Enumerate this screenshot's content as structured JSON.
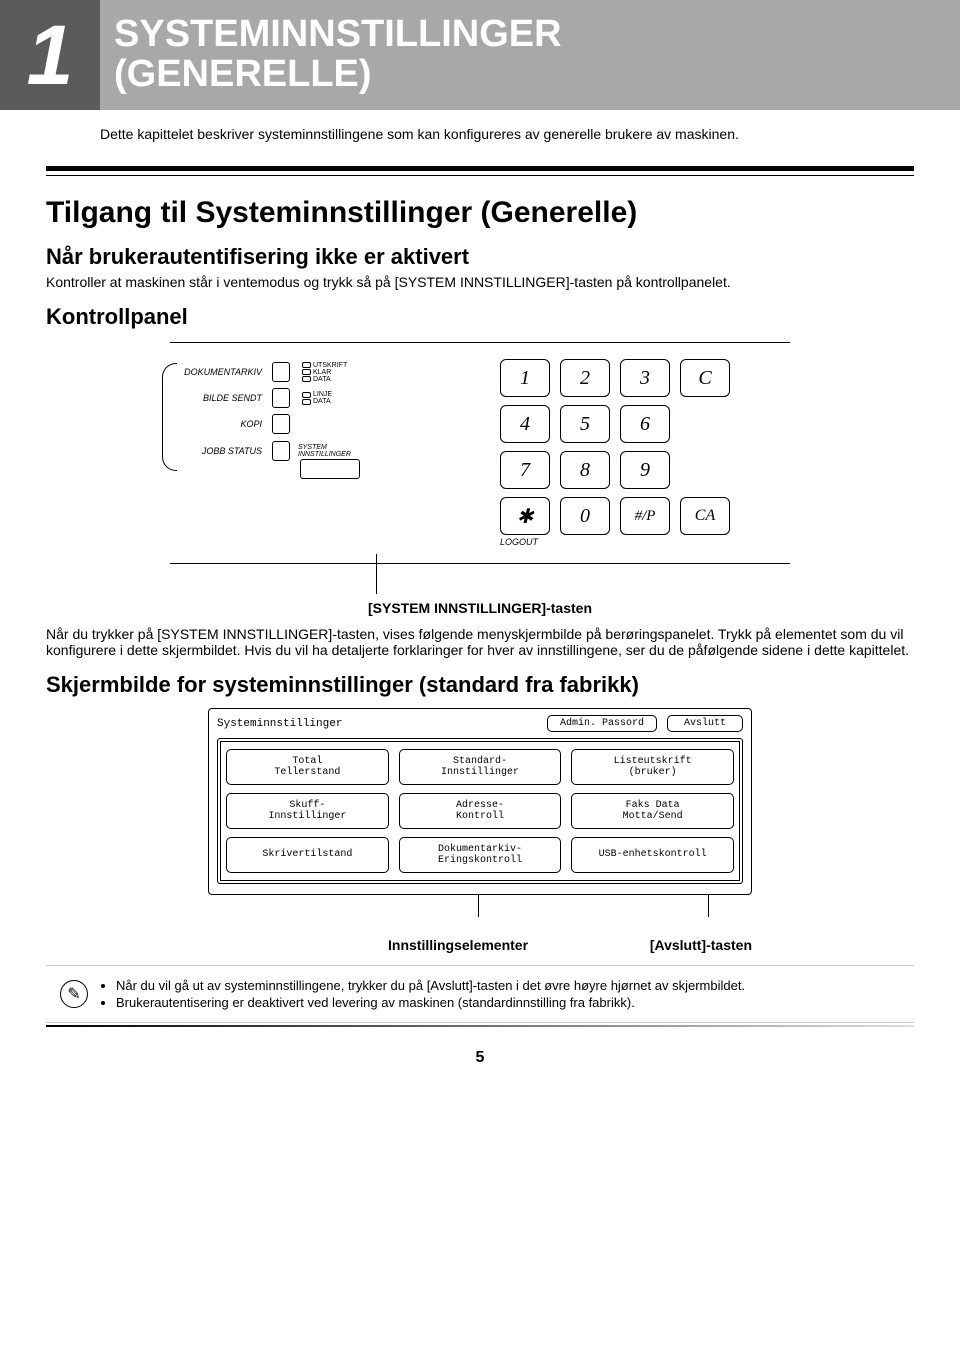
{
  "chapter": {
    "number": "1",
    "title_line1": "SYSTEMINNSTILLINGER",
    "title_line2": "(GENERELLE)"
  },
  "intro": "Dette kapittelet beskriver systeminnstillingene som kan konfigureres av generelle brukere av maskinen.",
  "section_heading": "Tilgang til Systeminnstillinger (Generelle)",
  "sub1_heading": "Når brukerautentifisering ikke er aktivert",
  "sub1_body": "Kontroller at maskinen står i ventemodus og trykk så på [SYSTEM INNSTILLINGER]-tasten på kontrollpanelet.",
  "cp_heading": "Kontrollpanel",
  "cp": {
    "r1": "DOKUMENTARKIV",
    "r2": "BILDE SENDT",
    "r3": "KOPI",
    "job_status": "JOBB STATUS",
    "sysinnst_l1": "SYSTEM",
    "sysinnst_l2": "INNSTILLINGER",
    "leds": {
      "utskrift": "UTSKRIFT",
      "klar": "KLAR",
      "data1": "DATA",
      "linje": "LINJE",
      "data2": "DATA"
    },
    "logout": "LOGOUT"
  },
  "keypad": {
    "k1": "1",
    "k2": "2",
    "k3": "3",
    "kc": "C",
    "k4": "4",
    "k5": "5",
    "k6": "6",
    "k7": "7",
    "k8": "8",
    "k9": "9",
    "kstar": "✱",
    "k0": "0",
    "khash": "#/P",
    "kca": "CA"
  },
  "cp_caption": "[SYSTEM INNSTILLINGER]-tasten",
  "after_cp_body": "Når du trykker på [SYSTEM INNSTILLINGER]-tasten, vises følgende menyskjermbilde på berøringspanelet. Trykk på elementet som du vil konfigurere i dette skjermbildet. Hvis du vil ha detaljerte forklaringer for hver av innstillingene, ser du de påfølgende sidene i dette kapittelet.",
  "sub2_heading": "Skjermbilde for systeminnstillinger (standard fra fabrikk)",
  "ss": {
    "title": "Systeminnstillinger",
    "admin_btn": "Admin. Passord",
    "end_btn": "Avslutt",
    "cells": [
      {
        "l1": "Total",
        "l2": "Tellerstand"
      },
      {
        "l1": "Standard-",
        "l2": "Innstillinger"
      },
      {
        "l1": "Listeutskrift",
        "l2": "(bruker)"
      },
      {
        "l1": "Skuff-",
        "l2": "Innstillinger"
      },
      {
        "l1": "Adresse-",
        "l2": "Kontroll"
      },
      {
        "l1": "Faks Data",
        "l2": "Motta/Send"
      },
      {
        "l1": "Skrivertilstand",
        "l2": ""
      },
      {
        "l1": "Dokumentarkiv-",
        "l2": "Eringskontroll"
      },
      {
        "l1": "USB-enhetskontroll",
        "l2": ""
      }
    ]
  },
  "under": {
    "left": "Innstillingselementer",
    "right": "[Avslutt]-tasten"
  },
  "notes": [
    "Når du vil gå ut av systeminnstillingene, trykker du på [Avslutt]-tasten i det øvre høyre hjørnet av skjermbildet.",
    "Brukerautentisering er deaktivert ved levering av maskinen (standardinnstilling fra fabrikk)."
  ],
  "page_number": "5"
}
